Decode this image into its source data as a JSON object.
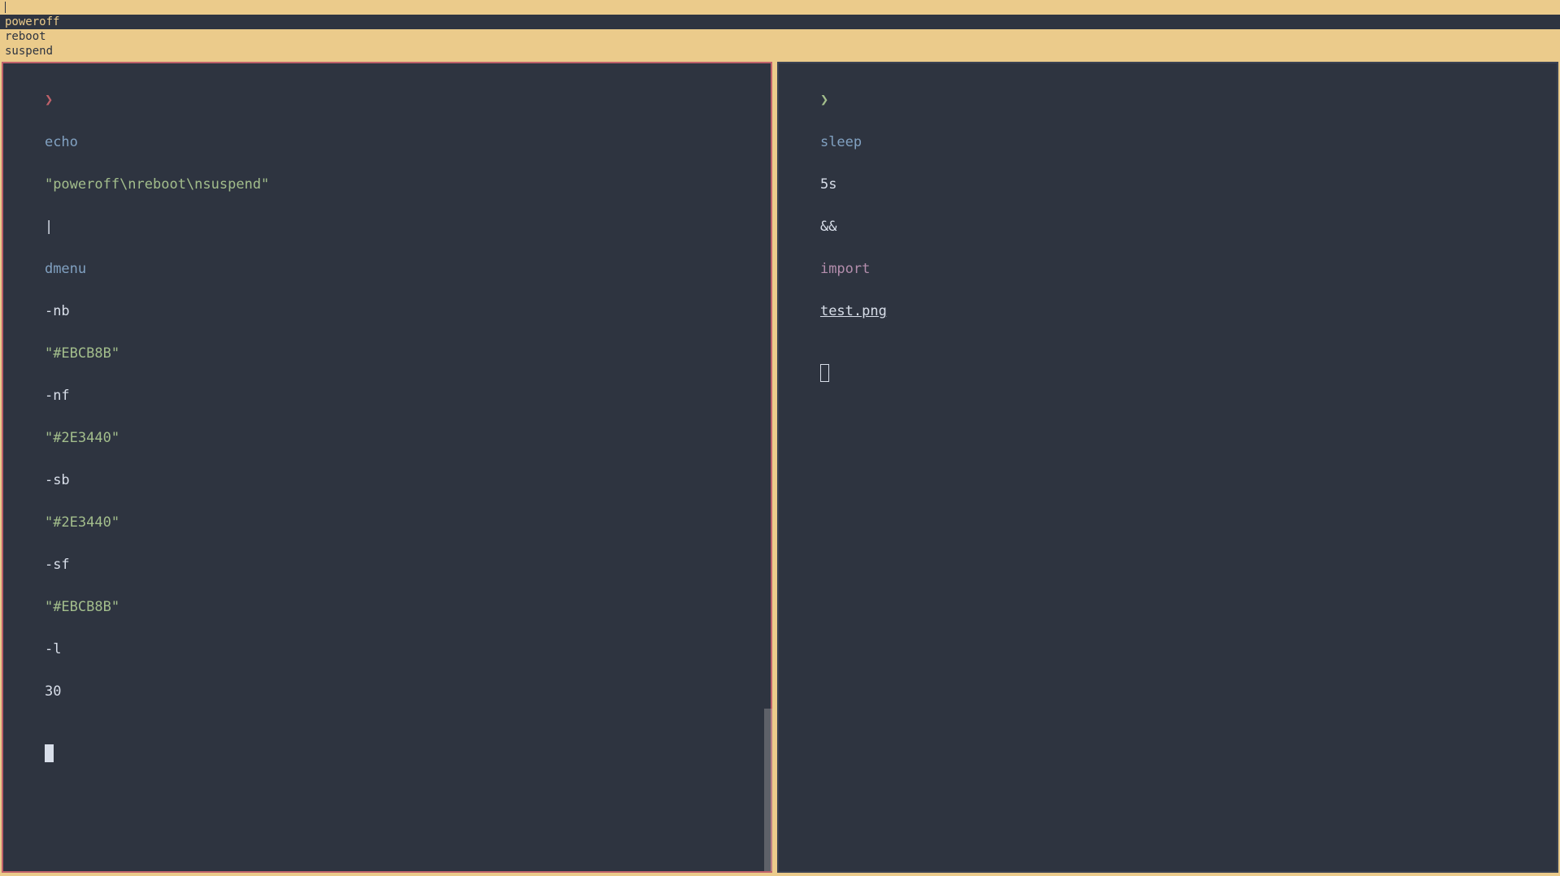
{
  "dmenu": {
    "input_value": "",
    "items": [
      {
        "label": "poweroff",
        "selected": true
      },
      {
        "label": "reboot",
        "selected": false
      },
      {
        "label": "suspend",
        "selected": false
      }
    ],
    "config": {
      "nb": "#EBCB8B",
      "nf": "#2E3440",
      "sb": "#2E3440",
      "sf": "#EBCB8B",
      "lines": 30
    }
  },
  "left_terminal": {
    "prompt": "❯",
    "cmd_tokens": {
      "echo": "echo",
      "echo_arg": "\"poweroff\\nreboot\\nsuspend\"",
      "pipe": "|",
      "dmenu": "dmenu",
      "flag_nb": "-nb",
      "val_nb": "\"#EBCB8B\"",
      "flag_nf": "-nf",
      "val_nf": "\"#2E3440\"",
      "flag_sb": "-sb",
      "val_sb": "\"#2E3440\"",
      "flag_sf": "-sf",
      "val_sf": "\"#EBCB8B\"",
      "flag_l": "-l",
      "val_l": "30"
    }
  },
  "right_terminal": {
    "prompt": "❯",
    "cmd_tokens": {
      "sleep": "sleep",
      "sleep_arg": "5s",
      "and": "&&",
      "import": "import",
      "import_arg": "test.png"
    }
  }
}
